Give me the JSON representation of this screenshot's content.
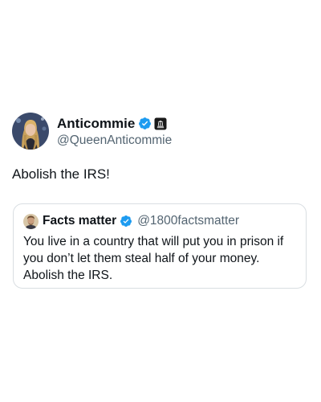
{
  "post": {
    "author": {
      "display_name": "Anticommie",
      "handle": "@QueenAnticommie",
      "avatar_icon": "profile-photo-woman-blonde",
      "verified_icon": "verified-checkmark-icon",
      "affiliate_badge_icon": "affiliate-badge-icon"
    },
    "text": "Abolish the IRS!"
  },
  "quoted_post": {
    "author": {
      "display_name": "Facts matter",
      "handle": "@1800factsmatter",
      "avatar_icon": "profile-photo-man",
      "verified_icon": "verified-checkmark-icon"
    },
    "text": "You live in a country that will put you in prison if you don’t let them steal half of your money. Abolish the IRS."
  },
  "colors": {
    "text_primary": "#0f1419",
    "text_secondary": "#536471",
    "verified_blue": "#1d9bf0",
    "quote_border": "#d9dee2",
    "background": "#ffffff"
  }
}
